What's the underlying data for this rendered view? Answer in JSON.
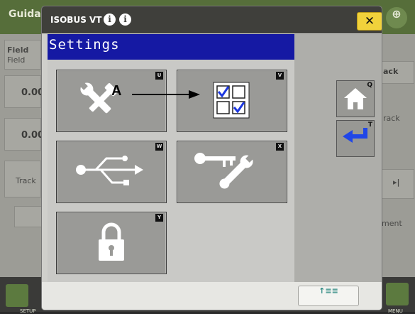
{
  "background": {
    "app_title": "Guida",
    "left_panel": {
      "field_label": "Field",
      "field_value": "Field",
      "value1": "0.00",
      "value2": "0.00",
      "track_label": "Track"
    },
    "right_panel": {
      "back_label": "ack",
      "track_label": "rack",
      "ment_label": "ment"
    },
    "bottom_left_label": "SETUP",
    "bottom_right_label": "MENU"
  },
  "dialog": {
    "title": "ISOBUS VT",
    "close_label": "✕",
    "settings_title": "Settings",
    "callout_label": "A",
    "tiles": [
      {
        "name": "tools",
        "key": "U"
      },
      {
        "name": "checklist",
        "key": "V"
      },
      {
        "name": "usb",
        "key": "W"
      },
      {
        "name": "key-wrench",
        "key": "X"
      },
      {
        "name": "lock",
        "key": "Y"
      }
    ],
    "side_buttons": [
      {
        "name": "home",
        "mini": "Q"
      },
      {
        "name": "back",
        "mini": "T"
      }
    ],
    "footer_button_label": "↑≡≡"
  },
  "colors": {
    "settings_bar": "#1519a3",
    "close_button": "#f1d23b",
    "check_blue": "#1d38e0",
    "arrow_blue": "#2046e8"
  }
}
